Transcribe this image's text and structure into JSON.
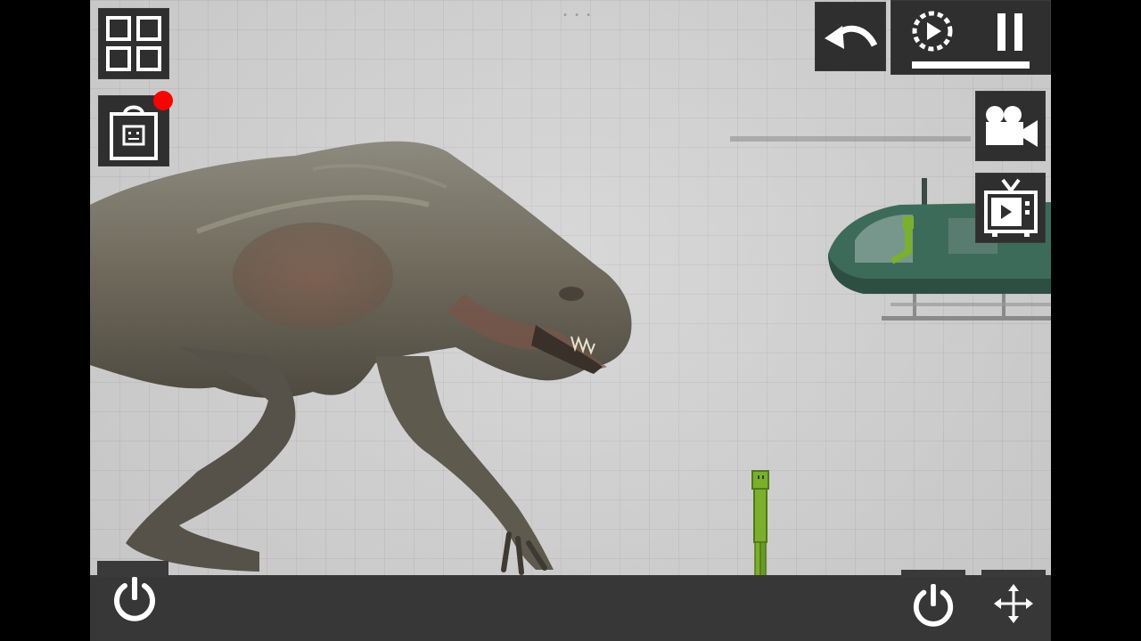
{
  "scene": {
    "background_color": "#cfcfcf",
    "floor_color": "#373737"
  },
  "toolbar": {
    "menu_icon": "grid-icon",
    "catalog_icon": "shop-bag-icon",
    "catalog_notification": true,
    "notification_color": "#ff0000",
    "undo_icon": "undo-arrow-icon",
    "slowmo_icon": "slow-motion-icon",
    "pause_icon": "pause-icon",
    "time_scale": 1.0,
    "camera_icon": "movie-camera-icon",
    "tv_icon": "tv-icon",
    "power_left_icon": "power-icon",
    "power_right_icon": "power-icon",
    "move_icon": "move-arrows-icon"
  },
  "entities": {
    "creature": "dinosaur",
    "ragdoll_color": "#7ab02a",
    "helicopter_color": "#3d6b5a"
  }
}
